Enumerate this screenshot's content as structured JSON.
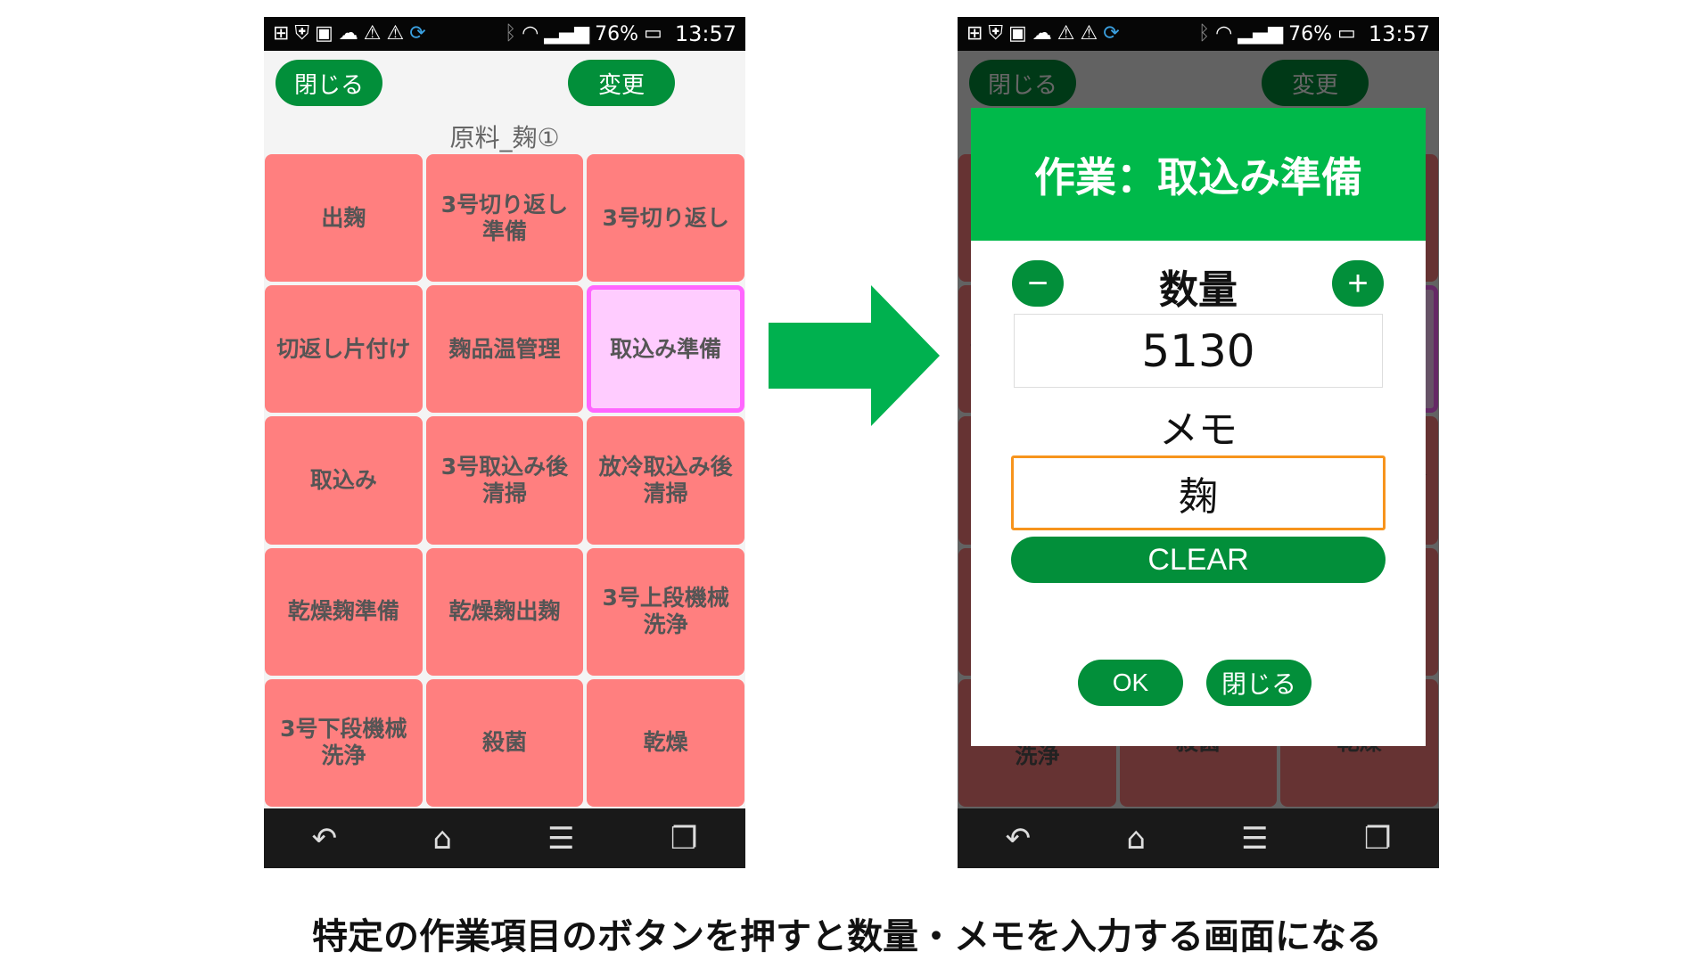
{
  "status_bar": {
    "battery": "76%",
    "time": "13:57"
  },
  "screen": {
    "close_label": "閉じる",
    "change_label": "変更",
    "title": "原料_麹①",
    "tasks": [
      "出麹",
      "3号切り返し\n準備",
      "3号切り返し",
      "切返し片付け",
      "麹品温管理",
      "取込み準備",
      "取込み",
      "3号取込み後\n清掃",
      "放冷取込み後\n清掃",
      "乾燥麹準備",
      "乾燥麹出麹",
      "3号上段機械\n洗浄",
      "3号下段機械\n洗浄",
      "殺菌",
      "乾燥"
    ],
    "selected_task": "取込み準備"
  },
  "dialog": {
    "title": "作業：取込み準備",
    "quantity_label": "数量",
    "quantity_value": "5130",
    "memo_label": "メモ",
    "memo_value": "麹",
    "clear_label": "CLEAR",
    "ok_label": "OK",
    "close_label": "閉じる",
    "minus": "−",
    "plus": "+"
  },
  "caption": "特定の作業項目のボタンを押すと数量・メモを入力する画面になる",
  "colors": {
    "accent": "#028f3a",
    "header": "#00b94a",
    "cell": "#ff7f7f",
    "selected": "#ffccff",
    "memo_border": "#f7941d"
  }
}
